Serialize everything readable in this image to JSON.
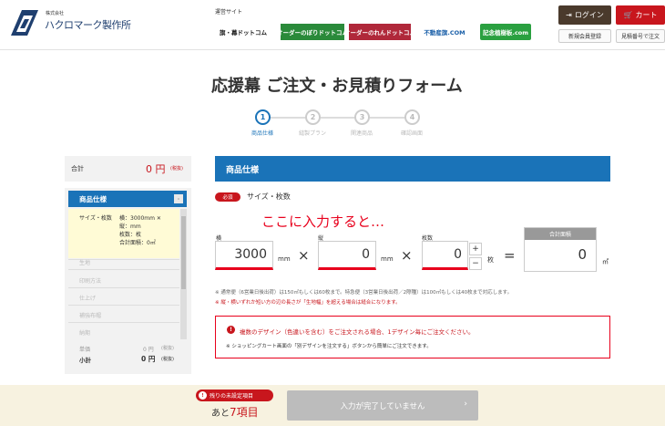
{
  "header": {
    "logo_small": "株式会社",
    "logo_name": "ハクロマーク製作所",
    "sites_title": "運営サイト",
    "sites": [
      {
        "label": "旗・幕ドットコム",
        "color": "#222"
      },
      {
        "label": "オーダーのぼりドットコム",
        "color": "#2a8a3a"
      },
      {
        "label": "オーダーのれんドットコム",
        "color": "#b0283a"
      },
      {
        "label": "不動産旗.COM",
        "color": "#1a5fa8"
      },
      {
        "label": "記念植樹板.com",
        "color": "#2aa040"
      }
    ],
    "login_label": "ログイン",
    "cart_label": "カート",
    "register_label": "新規会員登録",
    "order_by_quote_label": "見積番号で注文"
  },
  "page": {
    "title": "応援幕 ご注文・お見積りフォーム"
  },
  "steps": [
    {
      "num": "1",
      "label": "商品仕様",
      "active": true
    },
    {
      "num": "2",
      "label": "縫製プラン",
      "active": false
    },
    {
      "num": "3",
      "label": "関連商品",
      "active": false
    },
    {
      "num": "4",
      "label": "確認画面",
      "active": false
    }
  ],
  "sidebar": {
    "total_label": "合計",
    "total_value": "0 円",
    "total_tax": "(税抜)",
    "section_label": "商品仕様",
    "collapse_symbol": "-",
    "detail": {
      "size_label": "サイズ・枚数",
      "width": "横：3000mm ✕",
      "height": "縦：mm",
      "count": "枚数：枚",
      "area": "合計面積：0㎡"
    },
    "items": [
      "生地",
      "印刷方法",
      "仕上げ",
      "補強布帽",
      "納期"
    ],
    "unit_price_label": "単価",
    "unit_price_value": "0 円",
    "unit_price_tax": "(税抜)",
    "subtotal_label": "小計",
    "subtotal_value": "0 円",
    "subtotal_tax": "(税抜)"
  },
  "form": {
    "section_title": "商品仕様",
    "required_badge": "必須",
    "field_title": "サイズ・枚数",
    "overlay_text": "ここに入力すると…",
    "width_label": "横",
    "width_value": "3000",
    "width_unit": "mm",
    "height_label": "縦",
    "height_value": "0",
    "height_unit": "mm",
    "count_label": "枚数",
    "count_value": "0",
    "count_unit": "枚",
    "times_symbol": "×",
    "equals_symbol": "=",
    "plus_symbol": "+",
    "minus_symbol": "−",
    "area_label": "合計面積",
    "area_value": "0",
    "area_unit": "㎡",
    "note1": "※ 通常便（6営業日後出荷）は150㎡もしくは60枚まで。特急便（3営業日後出荷／2際種）は100㎡もしくは40枚まで対応します。",
    "note2": "※ 縦・横いずれか短い方の辺の長さが「生地幅」を超える場合は縫合になります。",
    "alert_icon": "!",
    "alert_main": "複数のデザイン（色違いを含む）をご注文される場合、1デザイン毎にご注文ください。",
    "alert_sub": "※ ショッピングカート画面の「別デザインを注文する」ボタンから簡単にご注文できます。"
  },
  "bottom": {
    "remain_badge": "残りの未設定項目",
    "remain_prefix": "あと",
    "remain_number": "7項目",
    "complete_label": "入力が完了していません",
    "complete_arrow": "›"
  },
  "colors": {
    "brand_blue": "#1a73b8",
    "accent_red": "#c8161d",
    "highlight_red": "#e8001c",
    "login_brown": "#4a3a2c"
  }
}
